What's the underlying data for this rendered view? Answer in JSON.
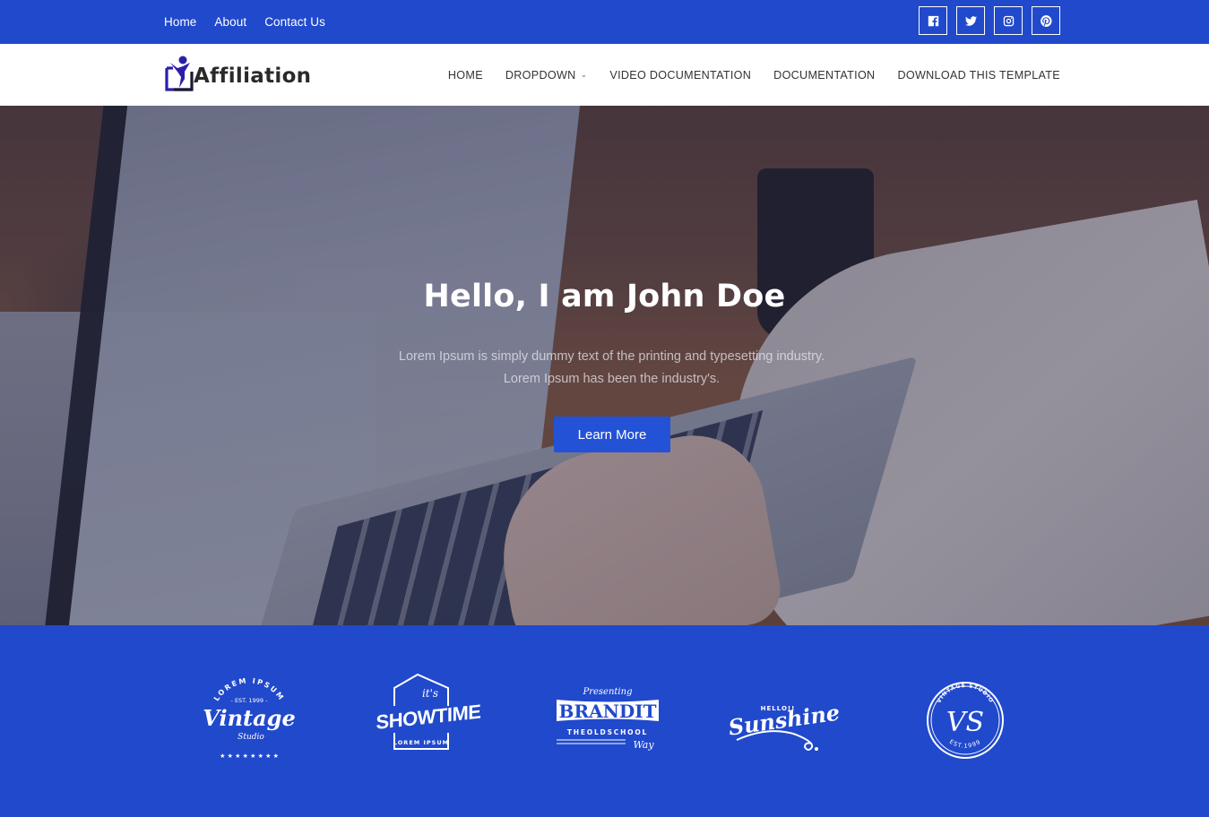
{
  "topbar": {
    "links": [
      {
        "label": "Home"
      },
      {
        "label": "About"
      },
      {
        "label": "Contact Us"
      }
    ],
    "social": [
      {
        "icon": "facebook-icon"
      },
      {
        "icon": "twitter-icon"
      },
      {
        "icon": "instagram-icon"
      },
      {
        "icon": "pinterest-icon"
      }
    ]
  },
  "navbar": {
    "logo_text": "Affiliation",
    "menu": [
      {
        "label": "HOME"
      },
      {
        "label": "DROPDOWN",
        "has_dropdown": true,
        "chevron": "⌄"
      },
      {
        "label": "VIDEO DOCUMENTATION"
      },
      {
        "label": "DOCUMENTATION"
      },
      {
        "label": "DOWNLOAD THIS TEMPLATE"
      }
    ]
  },
  "hero": {
    "title": "Hello, I am John Doe",
    "subtitle": "Lorem Ipsum is simply dummy text of the printing and typesetting industry. Lorem Ipsum has been the industry's.",
    "button_label": "Learn More"
  },
  "brands": [
    {
      "name": "vintage-studio",
      "top": "LOREM IPSUM",
      "est": "- EST. 1999 -",
      "main": "Vintage",
      "sub": "Studio",
      "stars": "★ ★ ★ ★ ★ ★ ★ ★"
    },
    {
      "name": "showtime",
      "top": "it's",
      "main": "SHOWTIME",
      "sub": "LOREM IPSUM"
    },
    {
      "name": "brandit",
      "top": "Presenting",
      "main": "BRANDIT",
      "sub": "THEOLDSCHOOL",
      "tail": "Way"
    },
    {
      "name": "sunshine",
      "top": "HELLO!!",
      "main": "Sunshine"
    },
    {
      "name": "vs-vintage-studio",
      "top": "VINTAGE STUDIO",
      "main": "VS",
      "sub": "EST.1999"
    }
  ],
  "colors": {
    "primary": "#2149cc",
    "button": "#2352d6",
    "logo_icon": "#2b1fa8"
  }
}
